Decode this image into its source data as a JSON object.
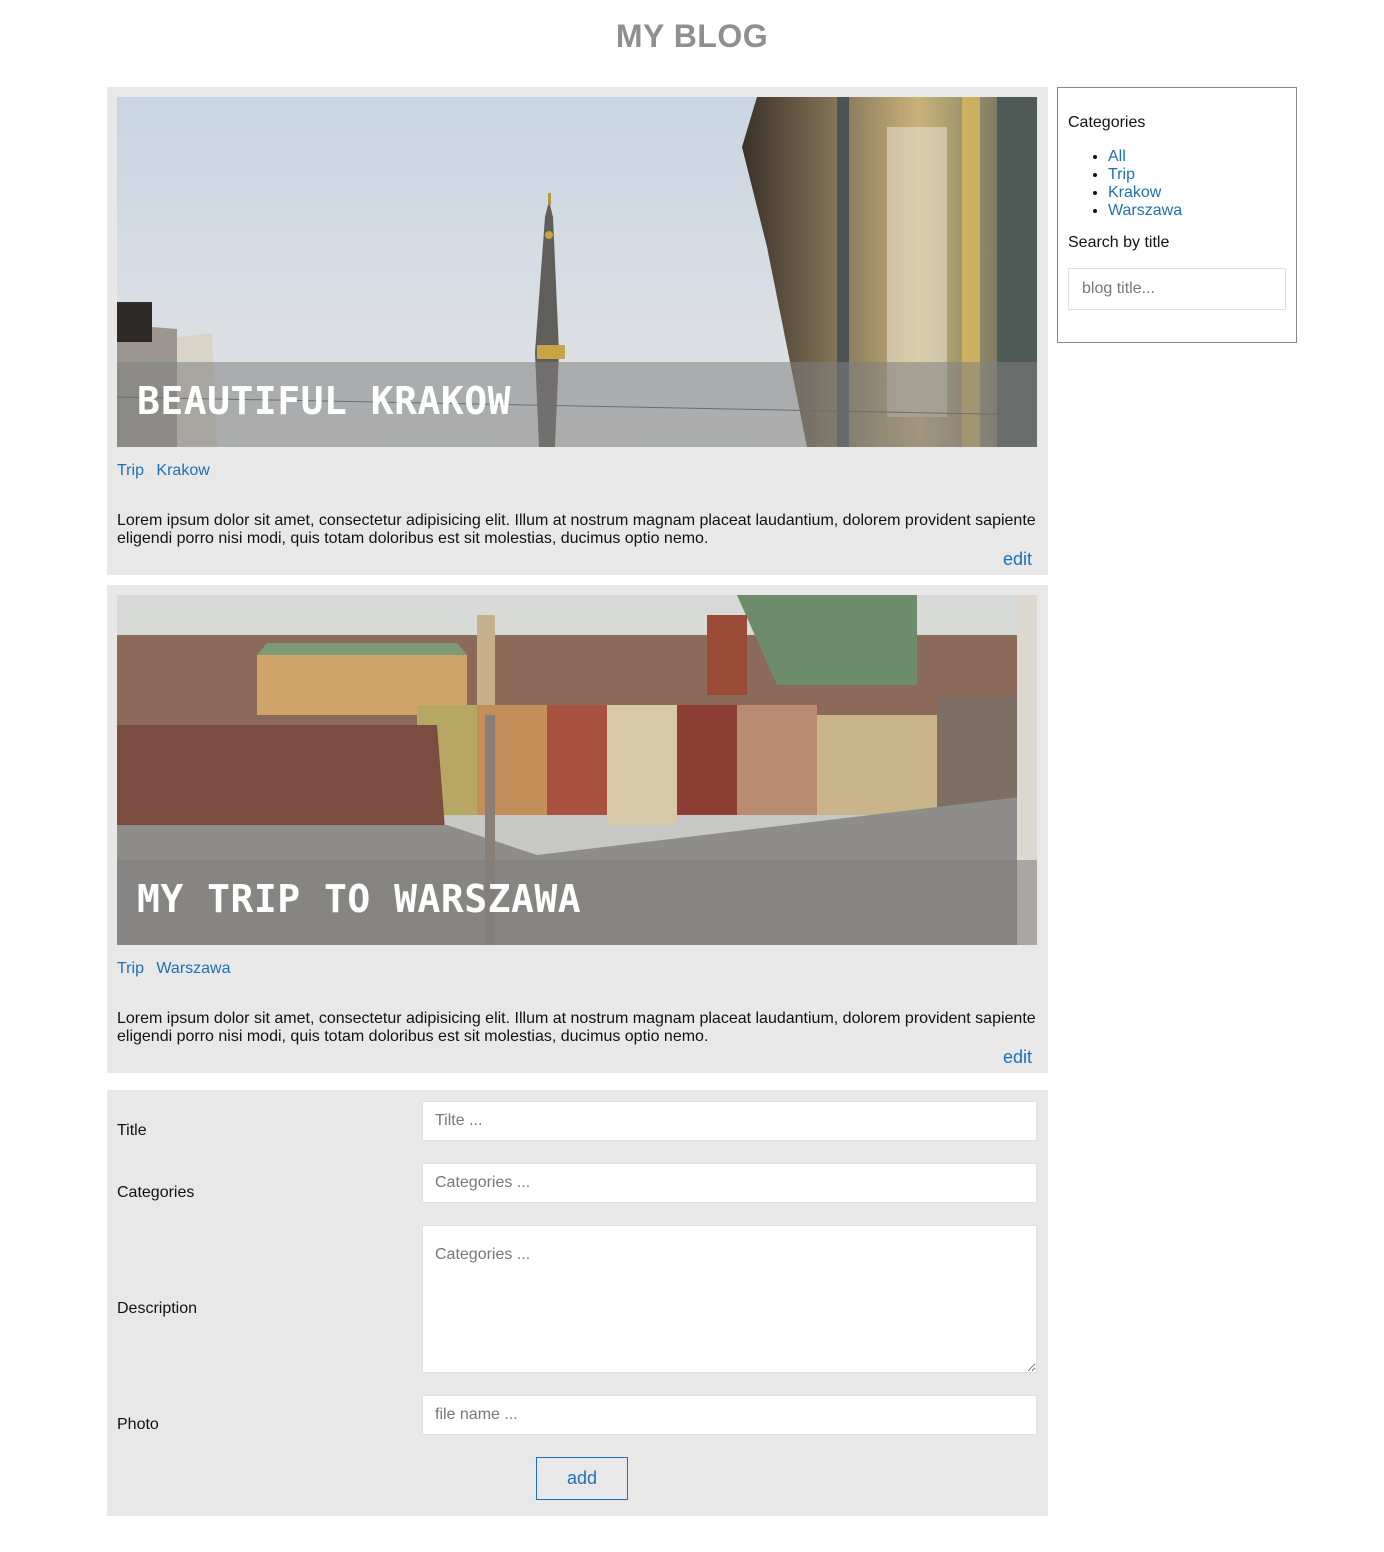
{
  "site": {
    "title": "MY BLOG"
  },
  "posts": [
    {
      "title": "BEAUTIFUL KRAKOW",
      "tags": [
        "Trip",
        "Krakow"
      ],
      "excerpt": "Lorem ipsum dolor sit amet, consectetur adipisicing elit. Illum at nostrum magnam placeat laudantium, dolorem provident sapiente eligendi porro nisi modi, quis totam doloribus est sit molestias, ducimus optio nemo.",
      "edit_label": "edit"
    },
    {
      "title": "MY TRIP TO WARSZAWA",
      "tags": [
        "Trip",
        "Warszawa"
      ],
      "excerpt": "Lorem ipsum dolor sit amet, consectetur adipisicing elit. Illum at nostrum magnam placeat laudantium, dolorem provident sapiente eligendi porro nisi modi, quis totam doloribus est sit molestias, ducimus optio nemo.",
      "edit_label": "edit"
    }
  ],
  "form": {
    "title_label": "Title",
    "title_placeholder": "Tilte ...",
    "categories_label": "Categories",
    "categories_placeholder": "Categories ...",
    "description_label": "Description",
    "description_placeholder": "Categories ...",
    "photo_label": "Photo",
    "photo_placeholder": "file name ...",
    "add_label": "add"
  },
  "sidebar": {
    "categories_heading": "Categories",
    "categories": [
      "All",
      "Trip",
      "Krakow",
      "Warszawa"
    ],
    "search_heading": "Search by title",
    "search_placeholder": "blog title..."
  },
  "colors": {
    "link": "#1f6fb5",
    "panel_bg": "#e8e8e8",
    "title_gray": "#8f8f8f"
  }
}
